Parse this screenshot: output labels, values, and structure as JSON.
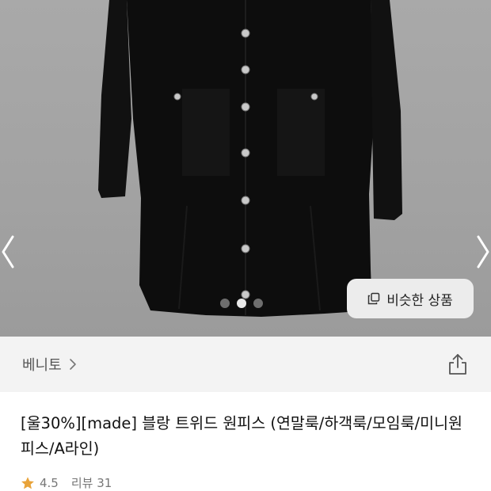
{
  "gallery": {
    "total_images": 3,
    "current_index": 2,
    "similar_products_label": "비슷한 상품"
  },
  "brand": {
    "name": "베니토"
  },
  "product": {
    "title": "[울30%][made] 블랑 트위드 원피스 (연말룩/하객룩/모임룩/미니원피스/A라인)",
    "rating": "4.5",
    "review_label": "리뷰 31"
  },
  "icons": {
    "prev": "chevron-left-icon",
    "next": "chevron-right-icon",
    "similar": "copy-stack-icon",
    "brand_arrow": "chevron-right-icon",
    "share": "share-icon",
    "star": "star-icon"
  },
  "colors": {
    "star": "#e8a33a",
    "overlay_bg": "#a5a5a5",
    "button_bg": "#ececec"
  }
}
